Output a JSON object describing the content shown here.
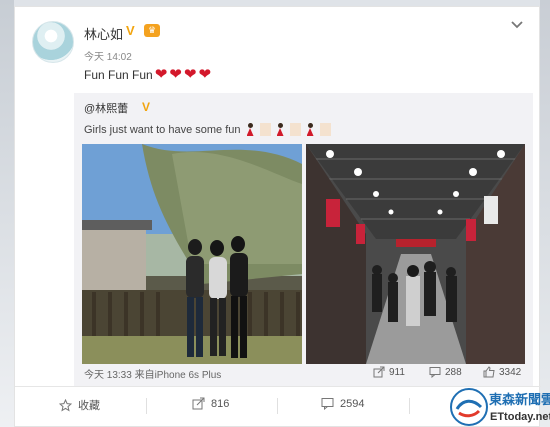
{
  "post": {
    "author": "林心如",
    "vip_mark": "V",
    "member_mark": "♛",
    "time": "今天 14:02",
    "text": "Fun Fun Fun",
    "hearts": [
      "❤",
      "❤",
      "❤",
      "❤"
    ]
  },
  "repost": {
    "author": "@林熙蕾",
    "vip_mark": "V",
    "text": "Girls just want to have some fun",
    "meta": "今天 13:33 来自iPhone 6s Plus",
    "reposts": "911",
    "comments": "288",
    "likes": "3342"
  },
  "actions": {
    "favorite": "收藏",
    "share": "816",
    "comment": "2594"
  },
  "watermark": {
    "name": "東森新聞雲",
    "site": "ETtoday.net"
  }
}
